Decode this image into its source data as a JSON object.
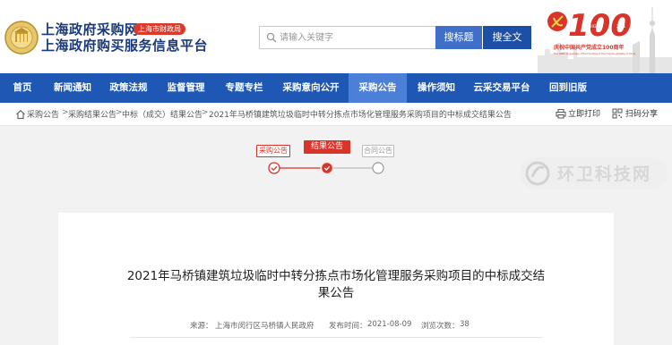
{
  "header": {
    "title_line1": "上海政府采购网",
    "badge": "上海市财政局",
    "title_line2": "上海政府购买服务信息平台",
    "centenary_caption": "庆祝中国共产党成立100周年",
    "centenary_caption_en": "The 100th Anniversary of the Founding of The Communist Party of China",
    "centenary_number": "100",
    "centenary_years": [
      "1921",
      "2021"
    ]
  },
  "search": {
    "placeholder": "请输入关键字",
    "btn_title": "搜标题",
    "btn_full": "搜全文"
  },
  "nav": {
    "items": [
      {
        "label": "首页"
      },
      {
        "label": "新闻通知"
      },
      {
        "label": "政策法规"
      },
      {
        "label": "监督管理"
      },
      {
        "label": "专题专栏"
      },
      {
        "label": "采购意向公开"
      },
      {
        "label": "采购公告"
      },
      {
        "label": "操作须知"
      },
      {
        "label": "云采交易平台"
      },
      {
        "label": "回到旧版"
      }
    ],
    "active_index": 6
  },
  "breadcrumb": {
    "items": [
      "采购公告",
      "采购结果公告",
      "中标（成交）结果公告",
      "2021年马桥镇建筑垃圾临时中转分拣点市场化管理服务采购项目的中标成交结果公告"
    ],
    "separator": ">"
  },
  "tools": {
    "print": "立即打印",
    "scan": "扫码分享"
  },
  "progress": {
    "steps": [
      {
        "label": "采购公告",
        "state": "done"
      },
      {
        "label": "结果公告",
        "state": "current"
      },
      {
        "label": "合同公告",
        "state": "pending"
      }
    ]
  },
  "watermark": {
    "text": "环卫科技网"
  },
  "article": {
    "title": "2021年马桥镇建筑垃圾临时中转分拣点市场化管理服务采购项目的中标成交结果公告",
    "source_label": "来源：",
    "source_value": "上海市闵行区马桥镇人民政府",
    "date_label": "发布时间：",
    "date_value": "2021-08-09",
    "views_label": "浏览次数：",
    "views_value": "38"
  },
  "colors": {
    "nav_bg": "#1f57b4",
    "nav_active": "#4b7fd8",
    "accent_red": "#d9332a",
    "title_blue": "#1b3a7a"
  }
}
